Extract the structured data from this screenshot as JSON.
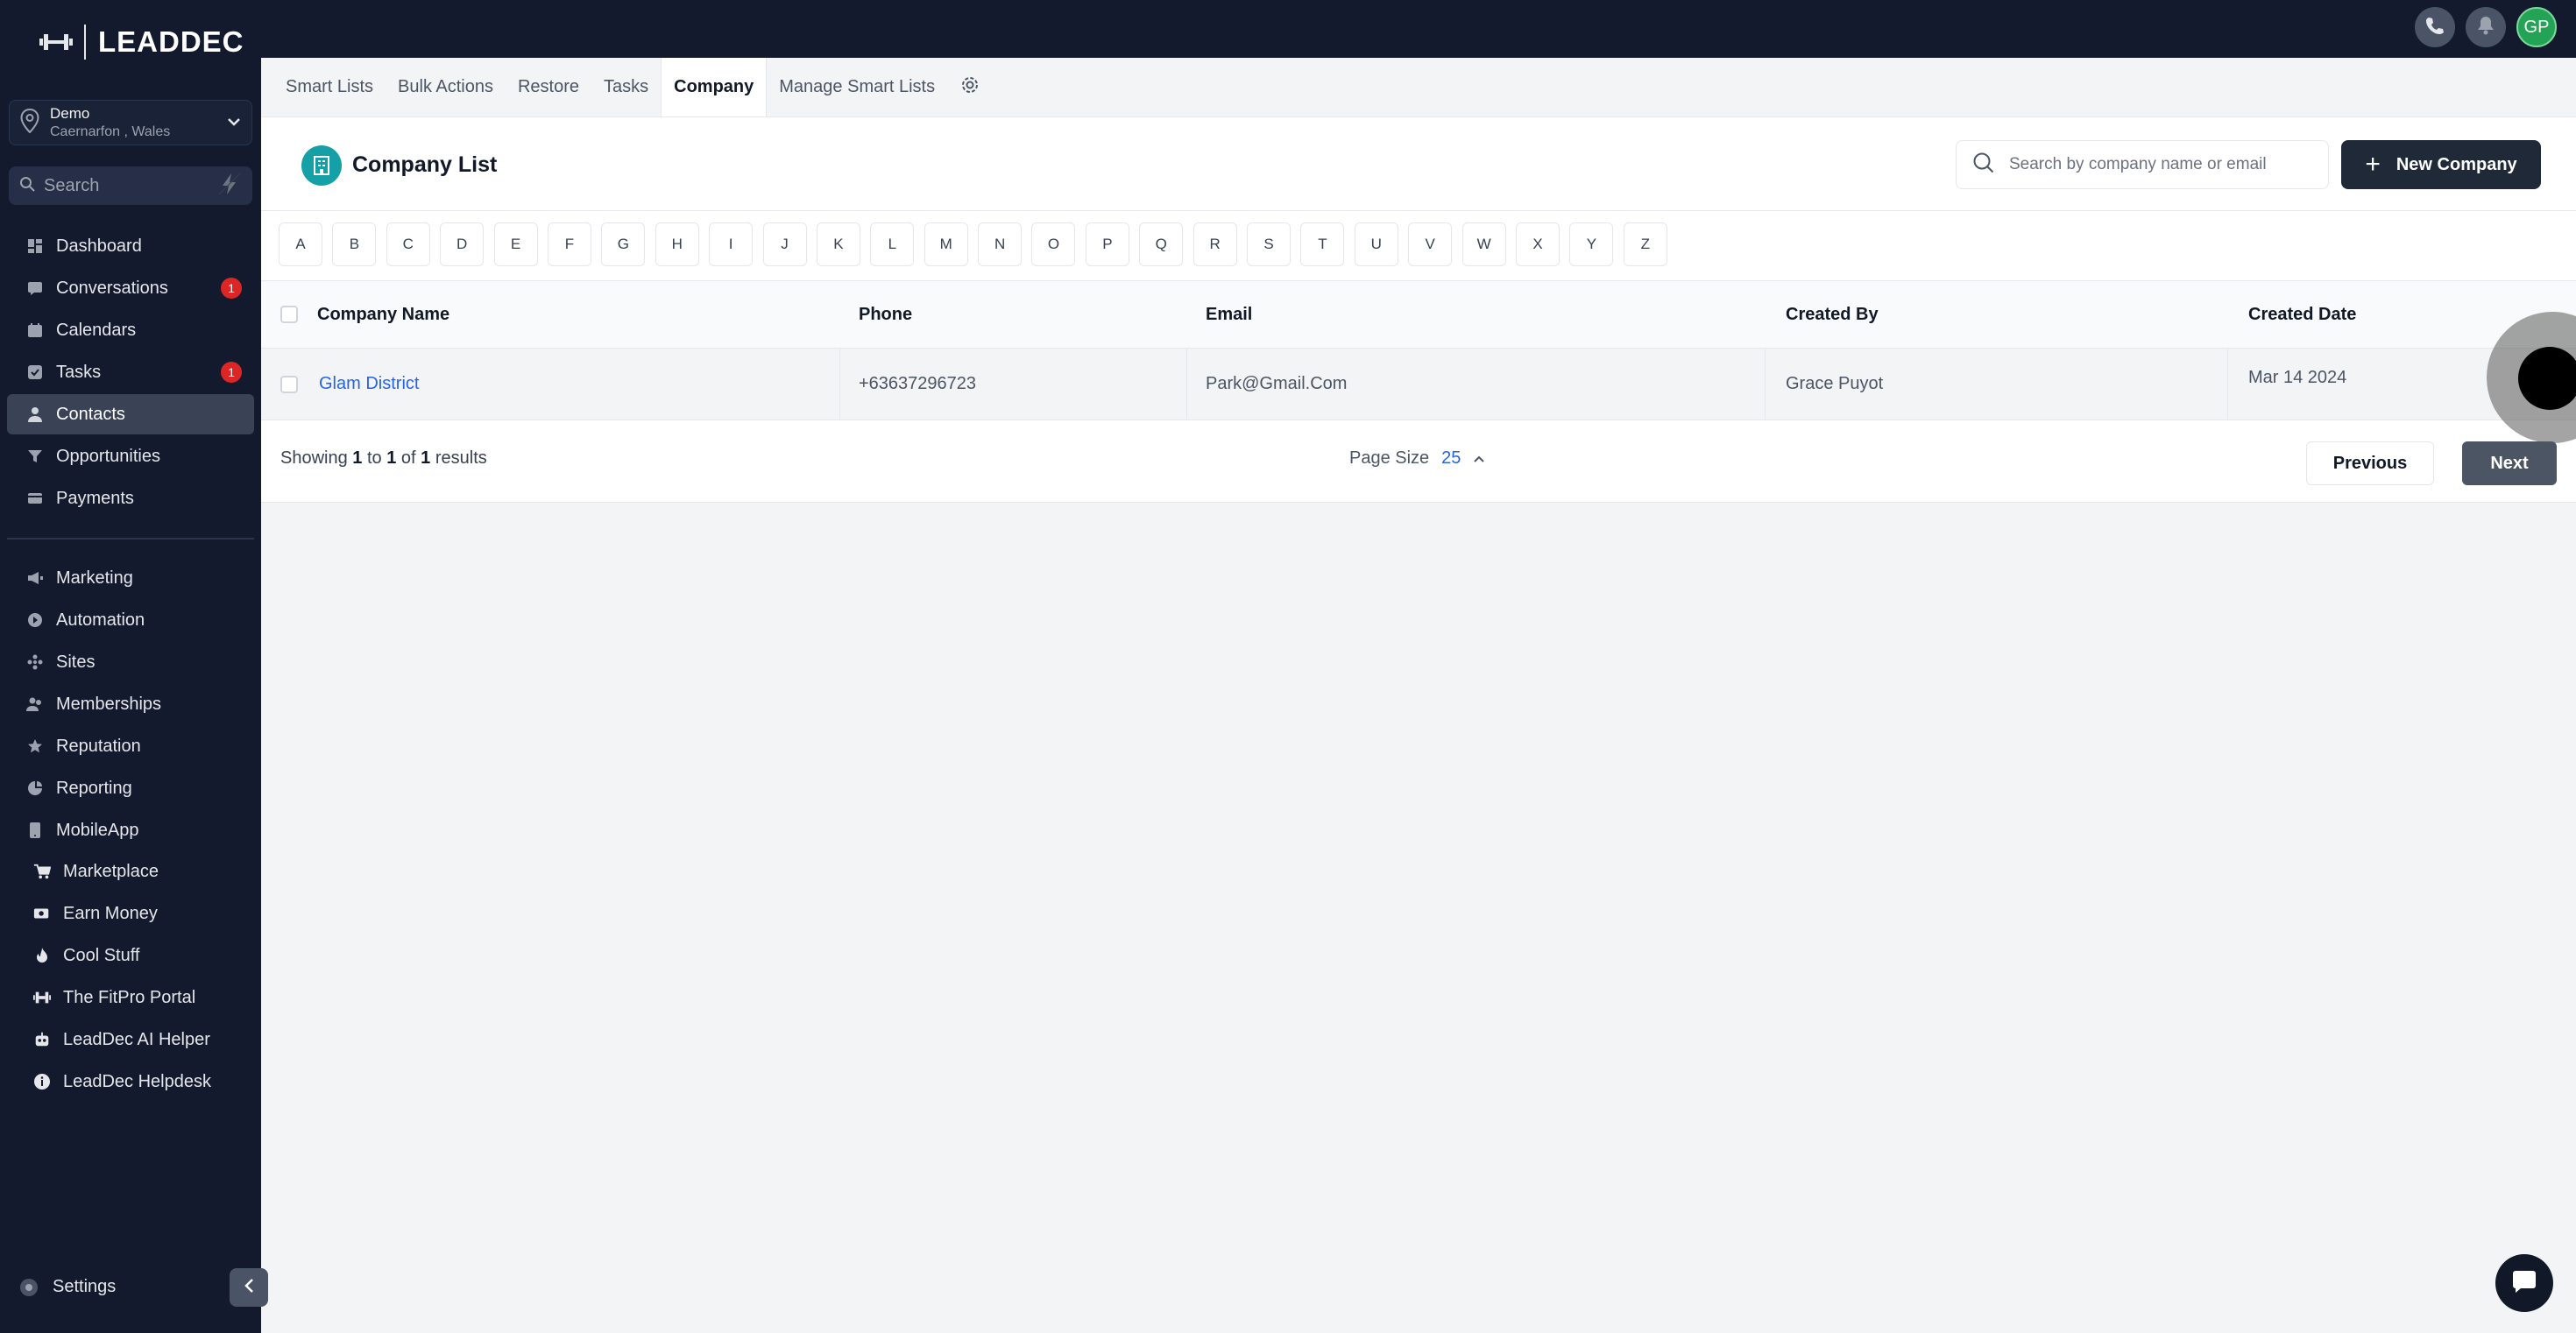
{
  "brand": {
    "name": "LEADDEC"
  },
  "location": {
    "name": "Demo",
    "sub": "Caernarfon , Wales"
  },
  "sidebar_search": {
    "placeholder": "Search"
  },
  "nav_primary": [
    {
      "label": "Dashboard",
      "icon": "dashboard-icon"
    },
    {
      "label": "Conversations",
      "icon": "chat-icon",
      "badge": "1"
    },
    {
      "label": "Calendars",
      "icon": "calendar-icon"
    },
    {
      "label": "Tasks",
      "icon": "checkbox-icon",
      "badge": "1"
    },
    {
      "label": "Contacts",
      "icon": "person-icon",
      "active": true
    },
    {
      "label": "Opportunities",
      "icon": "filter-icon"
    },
    {
      "label": "Payments",
      "icon": "card-icon"
    }
  ],
  "nav_secondary": [
    {
      "label": "Marketing",
      "icon": "megaphone-icon"
    },
    {
      "label": "Automation",
      "icon": "automation-icon"
    },
    {
      "label": "Sites",
      "icon": "sites-icon"
    },
    {
      "label": "Memberships",
      "icon": "members-icon"
    },
    {
      "label": "Reputation",
      "icon": "star-icon"
    },
    {
      "label": "Reporting",
      "icon": "chart-icon"
    },
    {
      "label": "MobileApp",
      "icon": "mobile-icon"
    }
  ],
  "nav_tertiary": [
    {
      "label": "Marketplace",
      "icon": "cart-icon"
    },
    {
      "label": "Earn Money",
      "icon": "money-icon"
    },
    {
      "label": "Cool Stuff",
      "icon": "fire-icon"
    },
    {
      "label": "The FitPro Portal",
      "icon": "dumbbell-icon"
    },
    {
      "label": "LeadDec AI Helper",
      "icon": "robot-icon"
    },
    {
      "label": "LeadDec Helpdesk",
      "icon": "info-icon"
    }
  ],
  "settings_label": "Settings",
  "user": {
    "initials": "GP"
  },
  "tabs": [
    {
      "label": "Smart Lists"
    },
    {
      "label": "Bulk Actions"
    },
    {
      "label": "Restore"
    },
    {
      "label": "Tasks"
    },
    {
      "label": "Company",
      "active": true
    },
    {
      "label": "Manage Smart Lists"
    }
  ],
  "page": {
    "title": "Company List",
    "search_placeholder": "Search by company name or email",
    "new_button": "New Company"
  },
  "alphabet": [
    "A",
    "B",
    "C",
    "D",
    "E",
    "F",
    "G",
    "H",
    "I",
    "J",
    "K",
    "L",
    "M",
    "N",
    "O",
    "P",
    "Q",
    "R",
    "S",
    "T",
    "U",
    "V",
    "W",
    "X",
    "Y",
    "Z"
  ],
  "table": {
    "columns": [
      "Company Name",
      "Phone",
      "Email",
      "Created By",
      "Created Date"
    ],
    "rows": [
      {
        "company": "Glam District",
        "phone": "+63637296723",
        "email": "Park@Gmail.Com",
        "created_by": "Grace Puyot",
        "created_date": "Mar 14 2024"
      }
    ]
  },
  "pagination": {
    "showing_prefix": "Showing",
    "from": "1",
    "to_word": "to",
    "to": "1",
    "of_word": "of",
    "total": "1",
    "results_word": "results",
    "page_size_label": "Page Size",
    "page_size": "25",
    "prev": "Previous",
    "next": "Next"
  },
  "colors": {
    "sidebar_bg": "#131a2e",
    "accent_teal": "#14a0a6",
    "link_blue": "#2563eb",
    "badge_red": "#dc2626"
  }
}
